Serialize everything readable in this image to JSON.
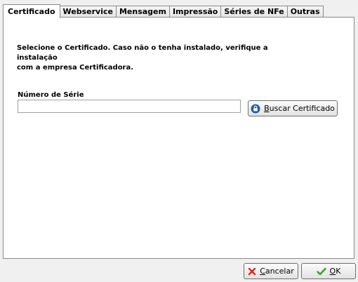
{
  "tabs": [
    {
      "label": "Certificado",
      "active": true
    },
    {
      "label": "Webservice"
    },
    {
      "label": "Mensagem"
    },
    {
      "label": "Impressão"
    },
    {
      "label": "Séries de NFe"
    },
    {
      "label": "Outras"
    }
  ],
  "certificado": {
    "instructions_line1": "Selecione o Certificado. Caso não o tenha instalado, verifique a instalação",
    "instructions_line2": "com a empresa Certificadora.",
    "serial_label": "Número de Série",
    "serial_value": "",
    "search_button": {
      "accel": "B",
      "rest": "uscar Certificado"
    }
  },
  "footer": {
    "cancel_button": {
      "accel": "C",
      "rest": "ancelar"
    },
    "ok_button": {
      "accel": "O",
      "rest": "K"
    }
  },
  "colors": {
    "cancel_icon": "#d42a1c",
    "ok_icon": "#3a9a2a",
    "lock_icon": "#1f5fa8"
  }
}
